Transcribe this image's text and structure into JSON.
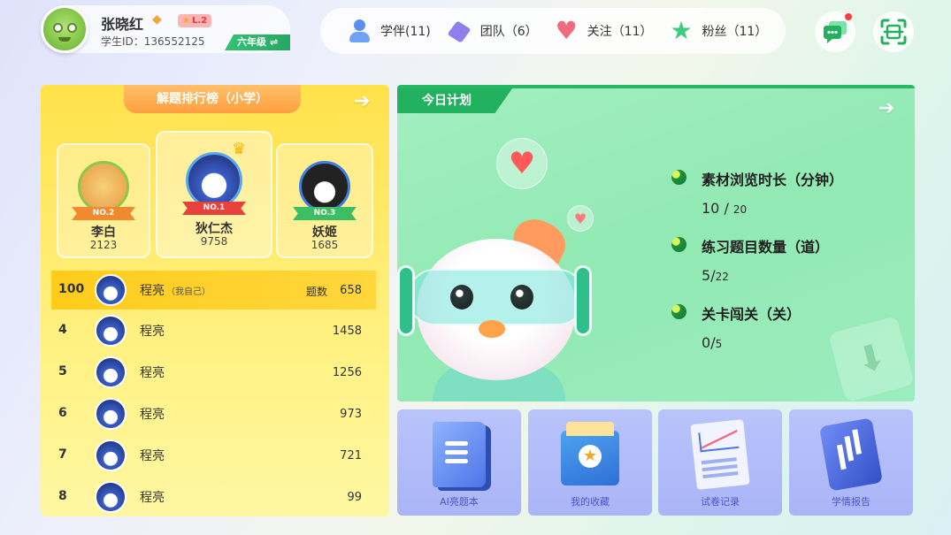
{
  "profile": {
    "name": "张晓红",
    "level": "L.2",
    "student_id": "学生ID：136552125",
    "grade": "六年级",
    "swap_icon": "⇌"
  },
  "social": {
    "items": [
      {
        "label": "学伴(11)",
        "icon": "partner-icon"
      },
      {
        "label": "团队（6）",
        "icon": "team-icon"
      },
      {
        "label": "关注（11）",
        "icon": "follow-heart-icon"
      },
      {
        "label": "粉丝（11）",
        "icon": "fans-star-icon"
      }
    ]
  },
  "colors": {
    "ranking_bg": "#ffe968",
    "ranking_title": "#ff9f40",
    "plan_bg": "#a3efc1",
    "plan_tab": "#22b25f",
    "tool_bg": "#b9c3fb",
    "grade_tag": "#35c274"
  },
  "ranking": {
    "title": "解题排行榜（小学）",
    "top3": [
      {
        "badge": "NO.2",
        "name": "李白",
        "score": "2123"
      },
      {
        "badge": "NO.1",
        "name": "狄仁杰",
        "score": "9758"
      },
      {
        "badge": "NO.3",
        "name": "妖姬",
        "score": "1685"
      }
    ],
    "me": {
      "rank": "100",
      "name": "程亮",
      "tag": "（我自己）",
      "count_label": "题数",
      "count": "658"
    },
    "rows": [
      {
        "rank": "4",
        "name": "程亮",
        "count": "1458"
      },
      {
        "rank": "5",
        "name": "程亮",
        "count": "1256"
      },
      {
        "rank": "6",
        "name": "程亮",
        "count": "973"
      },
      {
        "rank": "7",
        "name": "程亮",
        "count": "721"
      },
      {
        "rank": "8",
        "name": "程亮",
        "count": "99"
      }
    ]
  },
  "plan": {
    "title": "今日计划",
    "items": [
      {
        "label": "素材浏览时长（分钟）",
        "done": "10",
        "sep": " / ",
        "total": "20"
      },
      {
        "label": "练习题目数量（道）",
        "done": "5",
        "sep": "/",
        "total": "22"
      },
      {
        "label": "关卡闯关（关）",
        "done": "0",
        "sep": "/",
        "total": "5"
      }
    ]
  },
  "tools": [
    {
      "label": "AI亮题本",
      "icon": "book-icon"
    },
    {
      "label": "我的收藏",
      "icon": "star-folder-icon"
    },
    {
      "label": "试卷记录",
      "icon": "report-icon"
    },
    {
      "label": "学情报告",
      "icon": "tablet-chart-icon"
    }
  ]
}
